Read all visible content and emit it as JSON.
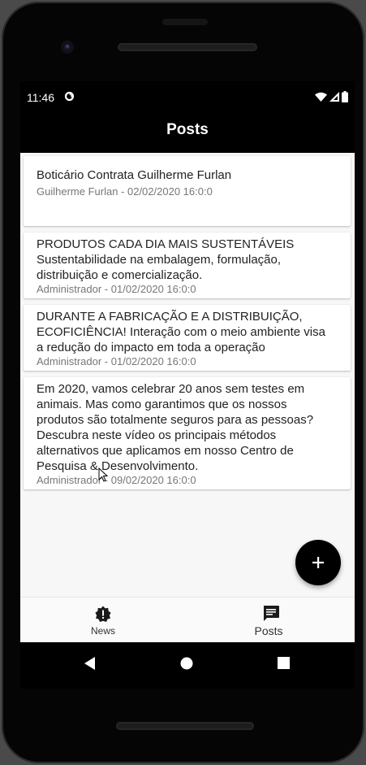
{
  "status_bar": {
    "time": "11:46"
  },
  "app_bar": {
    "title": "Posts"
  },
  "posts": [
    {
      "title": "Boticário Contrata Guilherme Furlan",
      "meta": "Guilherme Furlan - 02/02/2020 16:0:0"
    },
    {
      "title": "PRODUTOS CADA DIA MAIS SUSTENTÁVEIS\nSustentabilidade na embalagem, formulação,\ndistribuição e comercialização.",
      "meta": "Administrador - 01/02/2020 16:0:0"
    },
    {
      "title": "DURANTE A FABRICAÇÃO E A DISTRIBUIÇÃO,\nECOFICIÊNCIA! Interação com o meio ambiente visa\na redução do impacto em toda a operação",
      "meta": "Administrador - 01/02/2020 16:0:0"
    },
    {
      "title": "Em 2020, vamos celebrar 20 anos sem testes em\nanimais. Mas como garantimos que os nossos\nprodutos são totalmente seguros para as pessoas?\nDescubra neste vídeo os principais métodos\nalternativos que aplicamos em nosso Centro de\nPesquisa & Desenvolvimento.",
      "meta": "Administrador - 09/02/2020 16:0:0"
    }
  ],
  "bottom_nav": {
    "items": [
      {
        "label": "News",
        "icon": "news-badge-icon"
      },
      {
        "label": "Posts",
        "icon": "chat-bubble-icon",
        "selected": true
      }
    ]
  },
  "fab": {
    "icon": "plus-icon"
  },
  "colors": {
    "app_bar": "#000000",
    "content_background": "#f7f7f7",
    "card_background": "#ffffff",
    "fab": "#000000"
  }
}
